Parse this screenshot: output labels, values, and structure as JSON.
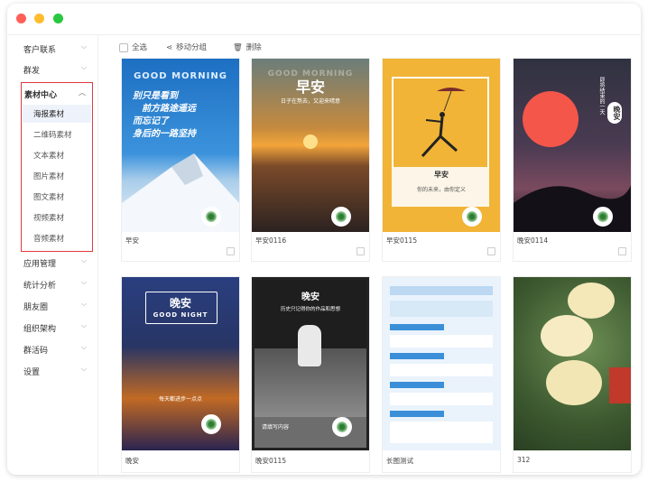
{
  "sidebar": {
    "top_items": [
      {
        "label": "客户联系"
      },
      {
        "label": "群发"
      }
    ],
    "group": {
      "label": "素材中心",
      "children": [
        {
          "label": "海报素材",
          "active": true
        },
        {
          "label": "二维码素材"
        },
        {
          "label": "文本素材"
        },
        {
          "label": "图片素材"
        },
        {
          "label": "图文素材"
        },
        {
          "label": "视频素材"
        },
        {
          "label": "音频素材"
        }
      ]
    },
    "bottom_items": [
      {
        "label": "应用管理"
      },
      {
        "label": "统计分析"
      },
      {
        "label": "朋友圈"
      },
      {
        "label": "组织架构"
      },
      {
        "label": "群活码"
      },
      {
        "label": "设置"
      }
    ]
  },
  "toolbar": {
    "select_all": "全选",
    "move_group": "移动分组",
    "delete": "删除"
  },
  "cards": [
    {
      "name": "早安",
      "poster_lines": [
        "GOOD MORNING",
        "别只是看到",
        "前方路途遥远",
        "而忘记了",
        "身后的一路坚持"
      ]
    },
    {
      "name": "早安0116",
      "poster_lines": [
        "早安",
        "GOOD MORNING",
        "日子在熬去，又迎来晴意"
      ]
    },
    {
      "name": "早安0115",
      "poster_lines": [
        "早安",
        "你的未来，由你定义"
      ]
    },
    {
      "name": "晚安0114",
      "poster_lines": [
        "晚安",
        "即将结束的一天"
      ]
    },
    {
      "name": "晚安",
      "poster_lines": [
        "晚安",
        "GOOD NIGHT",
        "每天都进步一点点"
      ]
    },
    {
      "name": "晚安0115",
      "poster_lines": [
        "晚安",
        "历史只记得你的作品和思想",
        "请填写内容"
      ]
    },
    {
      "name": "长图测试",
      "poster_lines": []
    },
    {
      "name": "312",
      "poster_lines": []
    }
  ],
  "colors": {
    "highlight_border": "#e0393e",
    "active_bg": "#eef3fb"
  }
}
